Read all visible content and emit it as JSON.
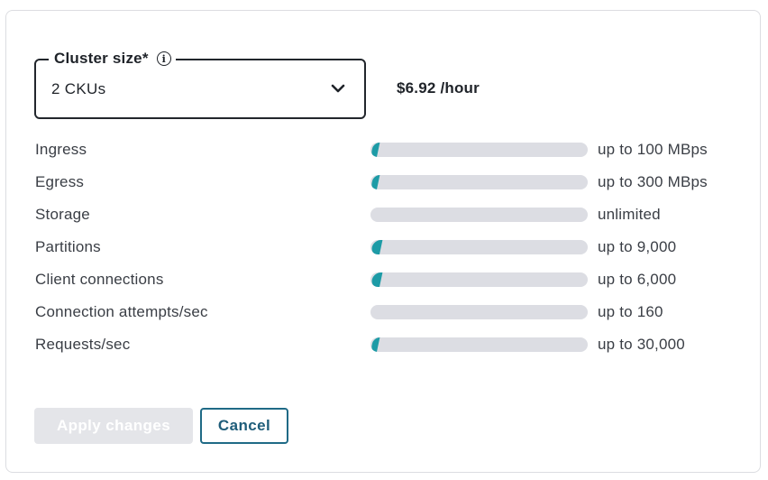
{
  "cluster_size": {
    "label": "Cluster size*",
    "info_icon": "info-circle-icon",
    "selected_value": "2 CKUs",
    "dropdown_icon": "chevron-down-icon"
  },
  "price": "$6.92 /hour",
  "limits": [
    {
      "label": "Ingress",
      "limit": "up to 100 MBps",
      "usage_fraction": 0.03
    },
    {
      "label": "Egress",
      "limit": "up to 300 MBps",
      "usage_fraction": 0.03
    },
    {
      "label": "Storage",
      "limit": "unlimited",
      "usage_fraction": 0
    },
    {
      "label": "Partitions",
      "limit": "up to 9,000",
      "usage_fraction": 0.04
    },
    {
      "label": "Client connections",
      "limit": "up to 6,000",
      "usage_fraction": 0.04
    },
    {
      "label": "Connection attempts/sec",
      "limit": "up to 160",
      "usage_fraction": 0
    },
    {
      "label": "Requests/sec",
      "limit": "up to 30,000",
      "usage_fraction": 0.03
    }
  ],
  "buttons": {
    "apply_label": "Apply changes",
    "apply_enabled": false,
    "cancel_label": "Cancel"
  },
  "colors": {
    "bar_fill": "#1d9ba6",
    "bar_track": "#dcdde3",
    "cancel_accent": "#1f6a86",
    "disabled_button": "#e4e5e9"
  }
}
